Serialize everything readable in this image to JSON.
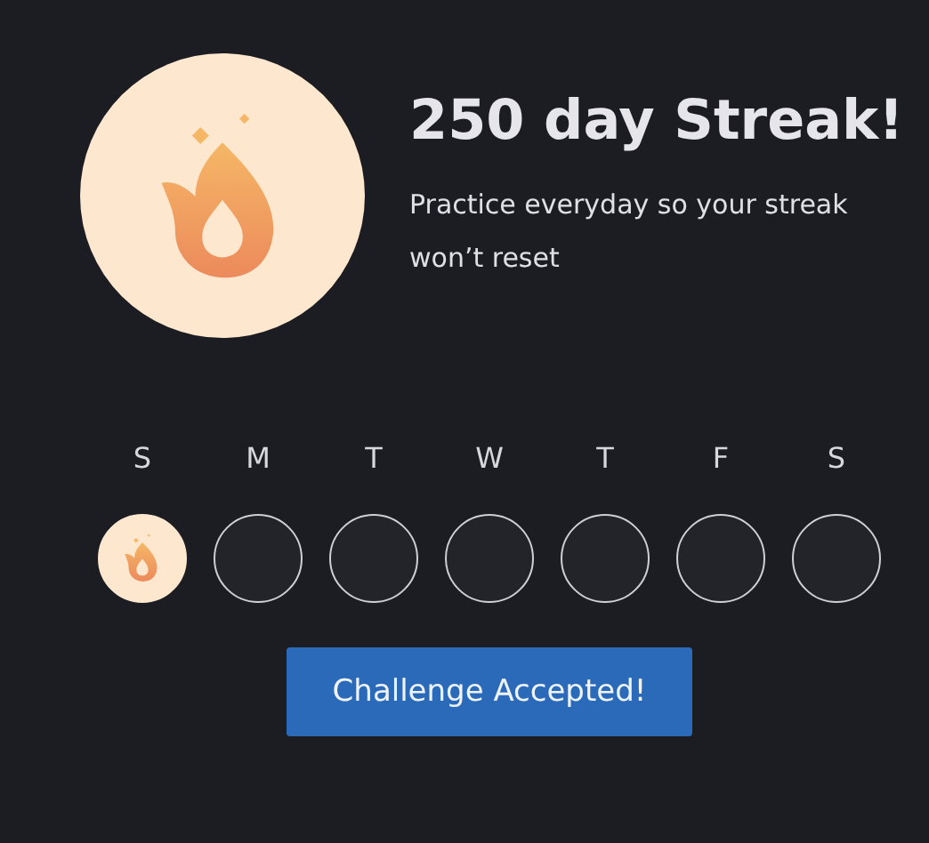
{
  "title": "250 day Streak!",
  "message": "Practice everyday so your streak won’t reset",
  "days": [
    {
      "label": "S",
      "done": true
    },
    {
      "label": "M",
      "done": false
    },
    {
      "label": "T",
      "done": false
    },
    {
      "label": "W",
      "done": false
    },
    {
      "label": "T",
      "done": false
    },
    {
      "label": "F",
      "done": false
    },
    {
      "label": "S",
      "done": false
    }
  ],
  "button": "Challenge Accepted!"
}
